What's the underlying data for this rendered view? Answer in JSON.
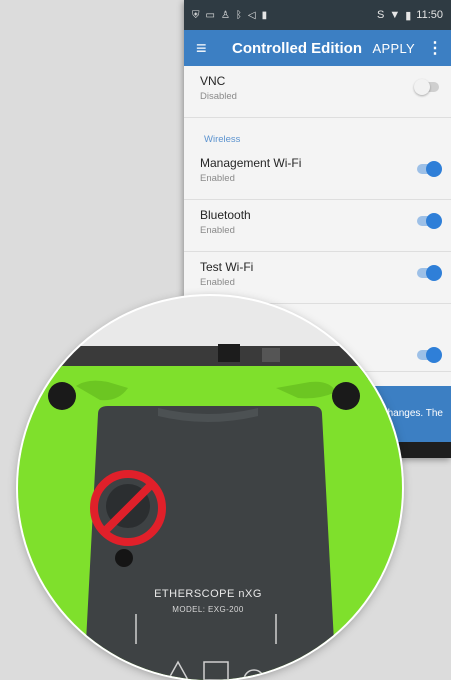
{
  "status_bar": {
    "time": "11:50",
    "left_icons": [
      "shield-icon",
      "cast-icon",
      "person-icon",
      "bluetooth-icon",
      "volume-icon",
      "image-icon"
    ],
    "right_icons": [
      "wifi-calling-icon",
      "wifi-icon",
      "battery-icon"
    ]
  },
  "app_bar": {
    "menu_icon": "≡",
    "title": "Controlled Edition",
    "apply_label": "APPLY",
    "more_icon": "⋮"
  },
  "settings": {
    "vnc": {
      "title": "VNC",
      "status": "Disabled",
      "on": false
    },
    "wireless_header": "Wireless",
    "management_wifi": {
      "title": "Management Wi-Fi",
      "status": "Enabled",
      "on": true
    },
    "bluetooth": {
      "title": "Bluetooth",
      "status": "Enabled",
      "on": true
    },
    "test_wifi": {
      "title": "Test Wi-Fi",
      "status": "Enabled",
      "on": true
    },
    "hidden_row": {
      "on": true
    }
  },
  "footer": {
    "text": "hanges. The"
  },
  "device": {
    "brand": "ETHERSCOPE nXG",
    "model": "MODEL: EXG-200",
    "body_color": "#7fe02c",
    "prohibited_color": "#e0202a"
  }
}
